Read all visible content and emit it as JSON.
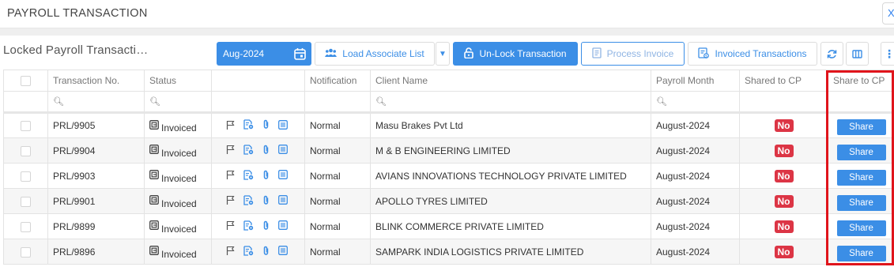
{
  "header": {
    "title": "PAYROLL TRANSACTION",
    "close_label": "X"
  },
  "toolbar": {
    "section_title": "Locked Payroll Transacti…",
    "month_value": "Aug-2024",
    "load_associate_label": "Load Associate List",
    "unlock_label": "Un-Lock Transaction",
    "process_invoice_label": "Process Invoice",
    "invoiced_transactions_label": "Invoiced Transactions"
  },
  "table": {
    "columns": {
      "transaction_no": "Transaction No.",
      "status": "Status",
      "actions": "",
      "notification": "Notification",
      "client_name": "Client Name",
      "payroll_month": "Payroll Month",
      "shared_to_cp": "Shared to CP",
      "share_to_cp": "Share to CP"
    },
    "rows": [
      {
        "transaction_no": "PRL/9905",
        "status": "Invoiced",
        "notification": "Normal",
        "client_name": "Masu Brakes Pvt Ltd",
        "payroll_month": "August-2024",
        "shared": "No",
        "share_label": "Share"
      },
      {
        "transaction_no": "PRL/9904",
        "status": "Invoiced",
        "notification": "Normal",
        "client_name": "M & B ENGINEERING LIMITED",
        "payroll_month": "August-2024",
        "shared": "No",
        "share_label": "Share"
      },
      {
        "transaction_no": "PRL/9903",
        "status": "Invoiced",
        "notification": "Normal",
        "client_name": "AVIANS INNOVATIONS TECHNOLOGY PRIVATE LIMITED",
        "payroll_month": "August-2024",
        "shared": "No",
        "share_label": "Share"
      },
      {
        "transaction_no": "PRL/9901",
        "status": "Invoiced",
        "notification": "Normal",
        "client_name": "APOLLO TYRES LIMITED",
        "payroll_month": "August-2024",
        "shared": "No",
        "share_label": "Share"
      },
      {
        "transaction_no": "PRL/9899",
        "status": "Invoiced",
        "notification": "Normal",
        "client_name": "BLINK COMMERCE PRIVATE LIMITED",
        "payroll_month": "August-2024",
        "shared": "No",
        "share_label": "Share"
      },
      {
        "transaction_no": "PRL/9896",
        "status": "Invoiced",
        "notification": "Normal",
        "client_name": "SAMPARK INDIA LOGISTICS PRIVATE LIMITED",
        "payroll_month": "August-2024",
        "shared": "No",
        "share_label": "Share"
      }
    ]
  },
  "colors": {
    "accent": "#3b8ee6",
    "danger": "#dc3545",
    "highlight": "#e0141b"
  },
  "icons": [
    "calendar-icon",
    "users-icon",
    "lock-icon",
    "document-icon",
    "invoice-icon",
    "refresh-icon",
    "columns-icon",
    "more-icon",
    "search-icon",
    "invoice-status-icon",
    "flag-icon",
    "file-settings-icon",
    "paperclip-icon",
    "list-icon"
  ]
}
